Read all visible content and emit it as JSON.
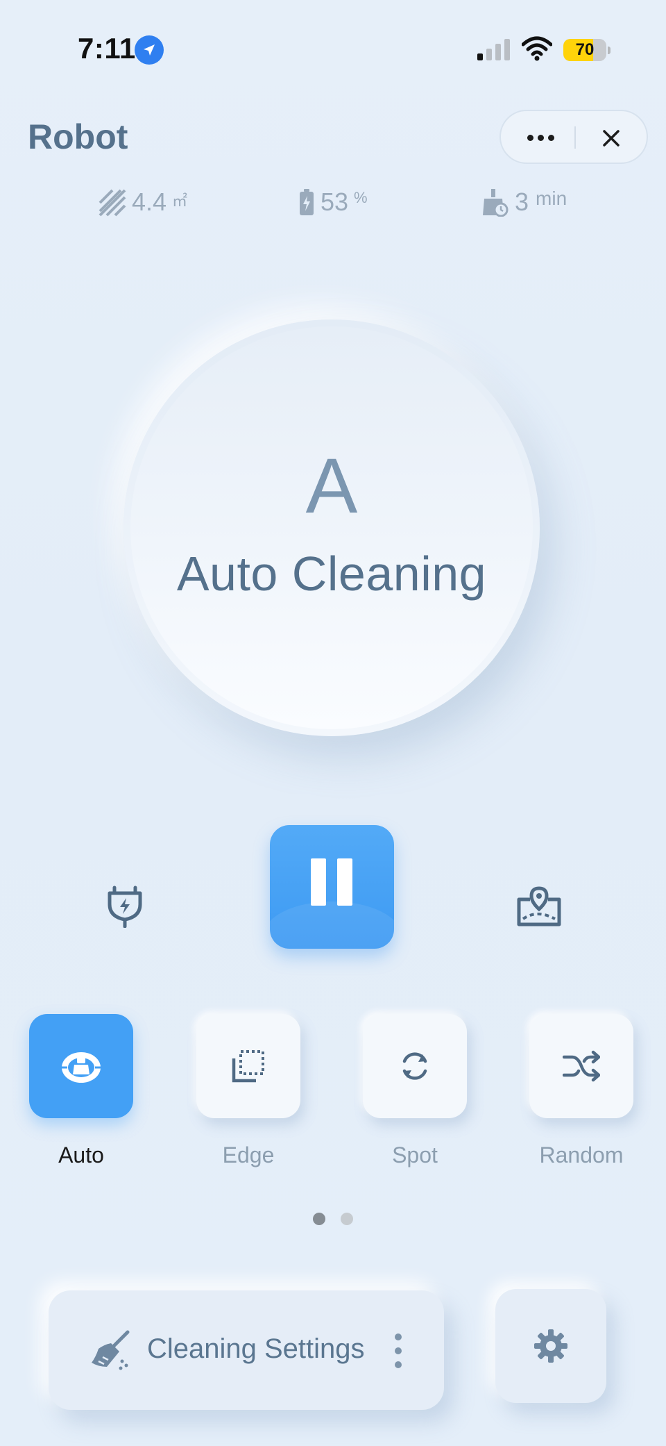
{
  "status_bar": {
    "time": "7:11",
    "battery_level": "70",
    "battery_fraction": 0.7,
    "location_icon": "location-arrow-icon",
    "signal_icon": "cellular-signal-icon",
    "wifi_icon": "wifi-icon"
  },
  "header": {
    "title": "Robot",
    "more_icon": "more-dots-icon",
    "close_icon": "close-icon"
  },
  "stats": {
    "area_value": "4.4",
    "area_unit": "㎡",
    "battery_value": "53",
    "battery_unit": "%",
    "time_value": "3",
    "time_unit": "min"
  },
  "status_circle": {
    "letter": "A",
    "mode_name": "Auto Cleaning"
  },
  "controls": {
    "dock_icon": "charging-dock-icon",
    "pause_icon": "pause-icon",
    "map_icon": "map-location-icon"
  },
  "modes": [
    {
      "label": "Auto",
      "icon": "auto-clean-icon",
      "active": true
    },
    {
      "label": "Edge",
      "icon": "edge-clean-icon",
      "active": false
    },
    {
      "label": "Spot",
      "icon": "spot-clean-icon",
      "active": false
    },
    {
      "label": "Random",
      "icon": "random-clean-icon",
      "active": false
    }
  ],
  "pager": {
    "pages": 2,
    "current": 1
  },
  "bottom": {
    "settings_label": "Cleaning Settings",
    "broom_icon": "broom-icon",
    "gear_icon": "gear-icon"
  },
  "colors": {
    "accent": "#43a0f5",
    "text_primary": "#55718c",
    "text_muted": "#9aaabb",
    "background": "#e4eef9"
  }
}
